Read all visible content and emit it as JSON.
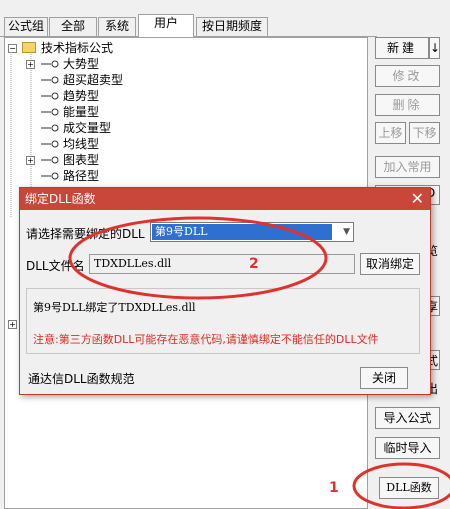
{
  "tabs": [
    "公式组",
    "全部",
    "系统",
    "用户",
    "按日期频度"
  ],
  "tree": {
    "root": "技术指标公式",
    "items": [
      "大势型",
      "超买超卖型",
      "趋势型",
      "能量型",
      "成交量型",
      "均线型",
      "图表型",
      "路径型"
    ]
  },
  "right_buttons": {
    "new": "新建",
    "modify": "修改",
    "delete": "删除",
    "move_up": "上移",
    "move_down": "下移",
    "add_common": "加入常用",
    "import": "导入公式",
    "temp_import": "临时导入",
    "dll": "DLL函数"
  },
  "partial_labels": {
    "p1": "D",
    "p2": "览",
    "p3": "享",
    "p4": "式",
    "p5": "出"
  },
  "dialog": {
    "title": "绑定DLL函数",
    "select_label": "请选择需要绑定的DLL",
    "select_value": "第9号DLL",
    "file_label": "DLL文件名",
    "file_value": "TDXDLLes.dll",
    "unbind_button": "取消绑定",
    "info_text": "第9号DLL绑定了TDXDLLes.dll",
    "warning_text": "注意:第三方函数DLL可能存在恶意代码,请谨慎绑定不能信任的DLL文件",
    "spec_link": "通达信DLL函数规范",
    "close_button": "关闭"
  },
  "annotations": {
    "label_1": "1",
    "label_2": "2"
  },
  "colors": {
    "title_bar": "#c9463b",
    "selection": "#2f6fcf",
    "annotation": "#e0322c"
  }
}
